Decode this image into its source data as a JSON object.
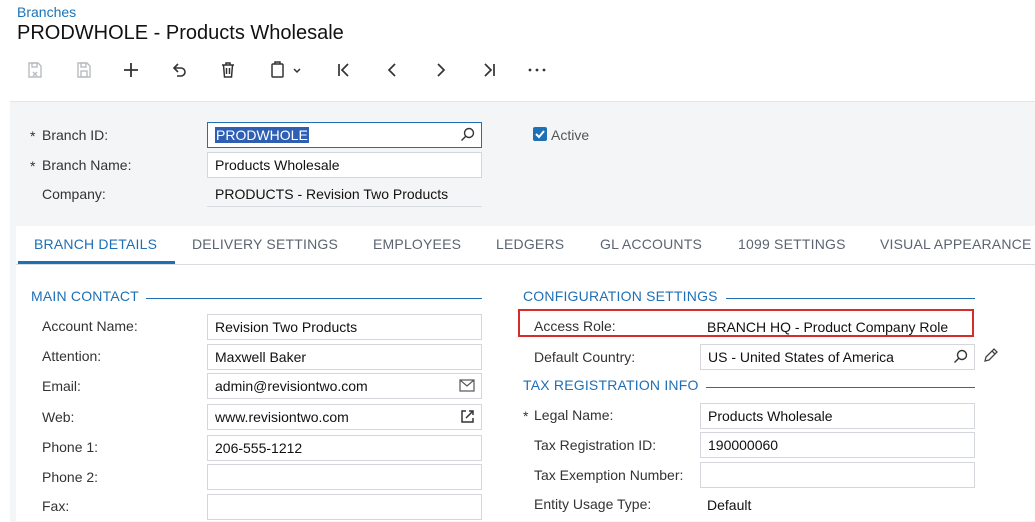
{
  "header": {
    "breadcrumb": "Branches",
    "title": "PRODWHOLE - Products Wholesale"
  },
  "toolbar": {
    "buttons": [
      {
        "name": "save-close-icon"
      },
      {
        "name": "save-icon"
      },
      {
        "name": "add-icon"
      },
      {
        "name": "undo-icon"
      },
      {
        "name": "delete-icon"
      },
      {
        "name": "copy-paste-icon"
      },
      {
        "name": "first-record-icon"
      },
      {
        "name": "previous-record-icon"
      },
      {
        "name": "next-record-icon"
      },
      {
        "name": "last-record-icon"
      },
      {
        "name": "more-icon"
      }
    ]
  },
  "summary": {
    "required_mark": "*",
    "branch_id_label": "Branch ID:",
    "branch_id_value": "PRODWHOLE",
    "branch_name_label": "Branch Name:",
    "branch_name_value": "Products Wholesale",
    "company_label": "Company:",
    "company_value": "PRODUCTS - Revision Two Products",
    "active_label": "Active",
    "active_checked": true
  },
  "tabs": [
    {
      "label": "BRANCH DETAILS",
      "active": true
    },
    {
      "label": "DELIVERY SETTINGS",
      "active": false
    },
    {
      "label": "EMPLOYEES",
      "active": false
    },
    {
      "label": "LEDGERS",
      "active": false
    },
    {
      "label": "GL ACCOUNTS",
      "active": false
    },
    {
      "label": "1099 SETTINGS",
      "active": false
    },
    {
      "label": "VISUAL APPEARANCE",
      "active": false
    }
  ],
  "main_contact": {
    "title": "MAIN CONTACT",
    "account_name_label": "Account Name:",
    "account_name_value": "Revision Two Products",
    "attention_label": "Attention:",
    "attention_value": "Maxwell Baker",
    "email_label": "Email:",
    "email_value": "admin@revisiontwo.com",
    "web_label": "Web:",
    "web_value": "www.revisiontwo.com",
    "phone1_label": "Phone 1:",
    "phone1_value": "206-555-1212",
    "phone2_label": "Phone 2:",
    "phone2_value": "",
    "fax_label": "Fax:",
    "fax_value": ""
  },
  "configuration": {
    "title": "CONFIGURATION SETTINGS",
    "access_role_label": "Access Role:",
    "access_role_value": "BRANCH HQ - Product Company Role",
    "default_country_label": "Default Country:",
    "default_country_value": "US - United States of America"
  },
  "tax_registration": {
    "title": "TAX REGISTRATION INFO",
    "legal_name_label": "Legal Name:",
    "legal_name_value": "Products Wholesale",
    "tax_id_label": "Tax Registration ID:",
    "tax_id_value": "190000060",
    "tax_exemption_label": "Tax Exemption Number:",
    "tax_exemption_value": "",
    "entity_usage_label": "Entity Usage Type:",
    "entity_usage_value": "Default"
  },
  "colors": {
    "accent": "#1f6fb5",
    "highlight_border": "#d62c2c",
    "panel_bg": "#f4f5f7"
  }
}
